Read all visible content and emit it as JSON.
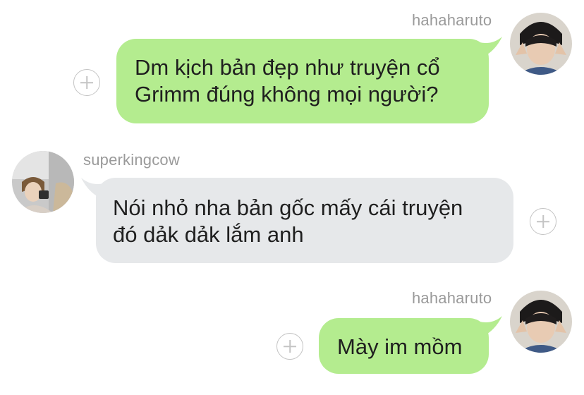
{
  "messages": [
    {
      "sender": "hahaharuto",
      "avatar": "avatar-photo",
      "lines": [
        "Dm kịch bản đẹp như truyện cổ",
        "Grimm đúng không mọi người?"
      ]
    },
    {
      "sender": "superkingcow",
      "avatar": "avatar-photo",
      "lines": [
        "Nói nhỏ nha bản gốc mấy cái truyện",
        "đó dảk dảk lắm anh"
      ]
    },
    {
      "sender": "hahaharuto",
      "avatar": "avatar-photo",
      "lines": [
        "Mày im mồm"
      ]
    }
  ],
  "icons": {
    "add_reaction": "plus-circle-icon"
  },
  "colors": {
    "outgoing_bubble": "#b4ec8f",
    "incoming_bubble": "#e6e8ea",
    "username": "#9a9a9a"
  }
}
